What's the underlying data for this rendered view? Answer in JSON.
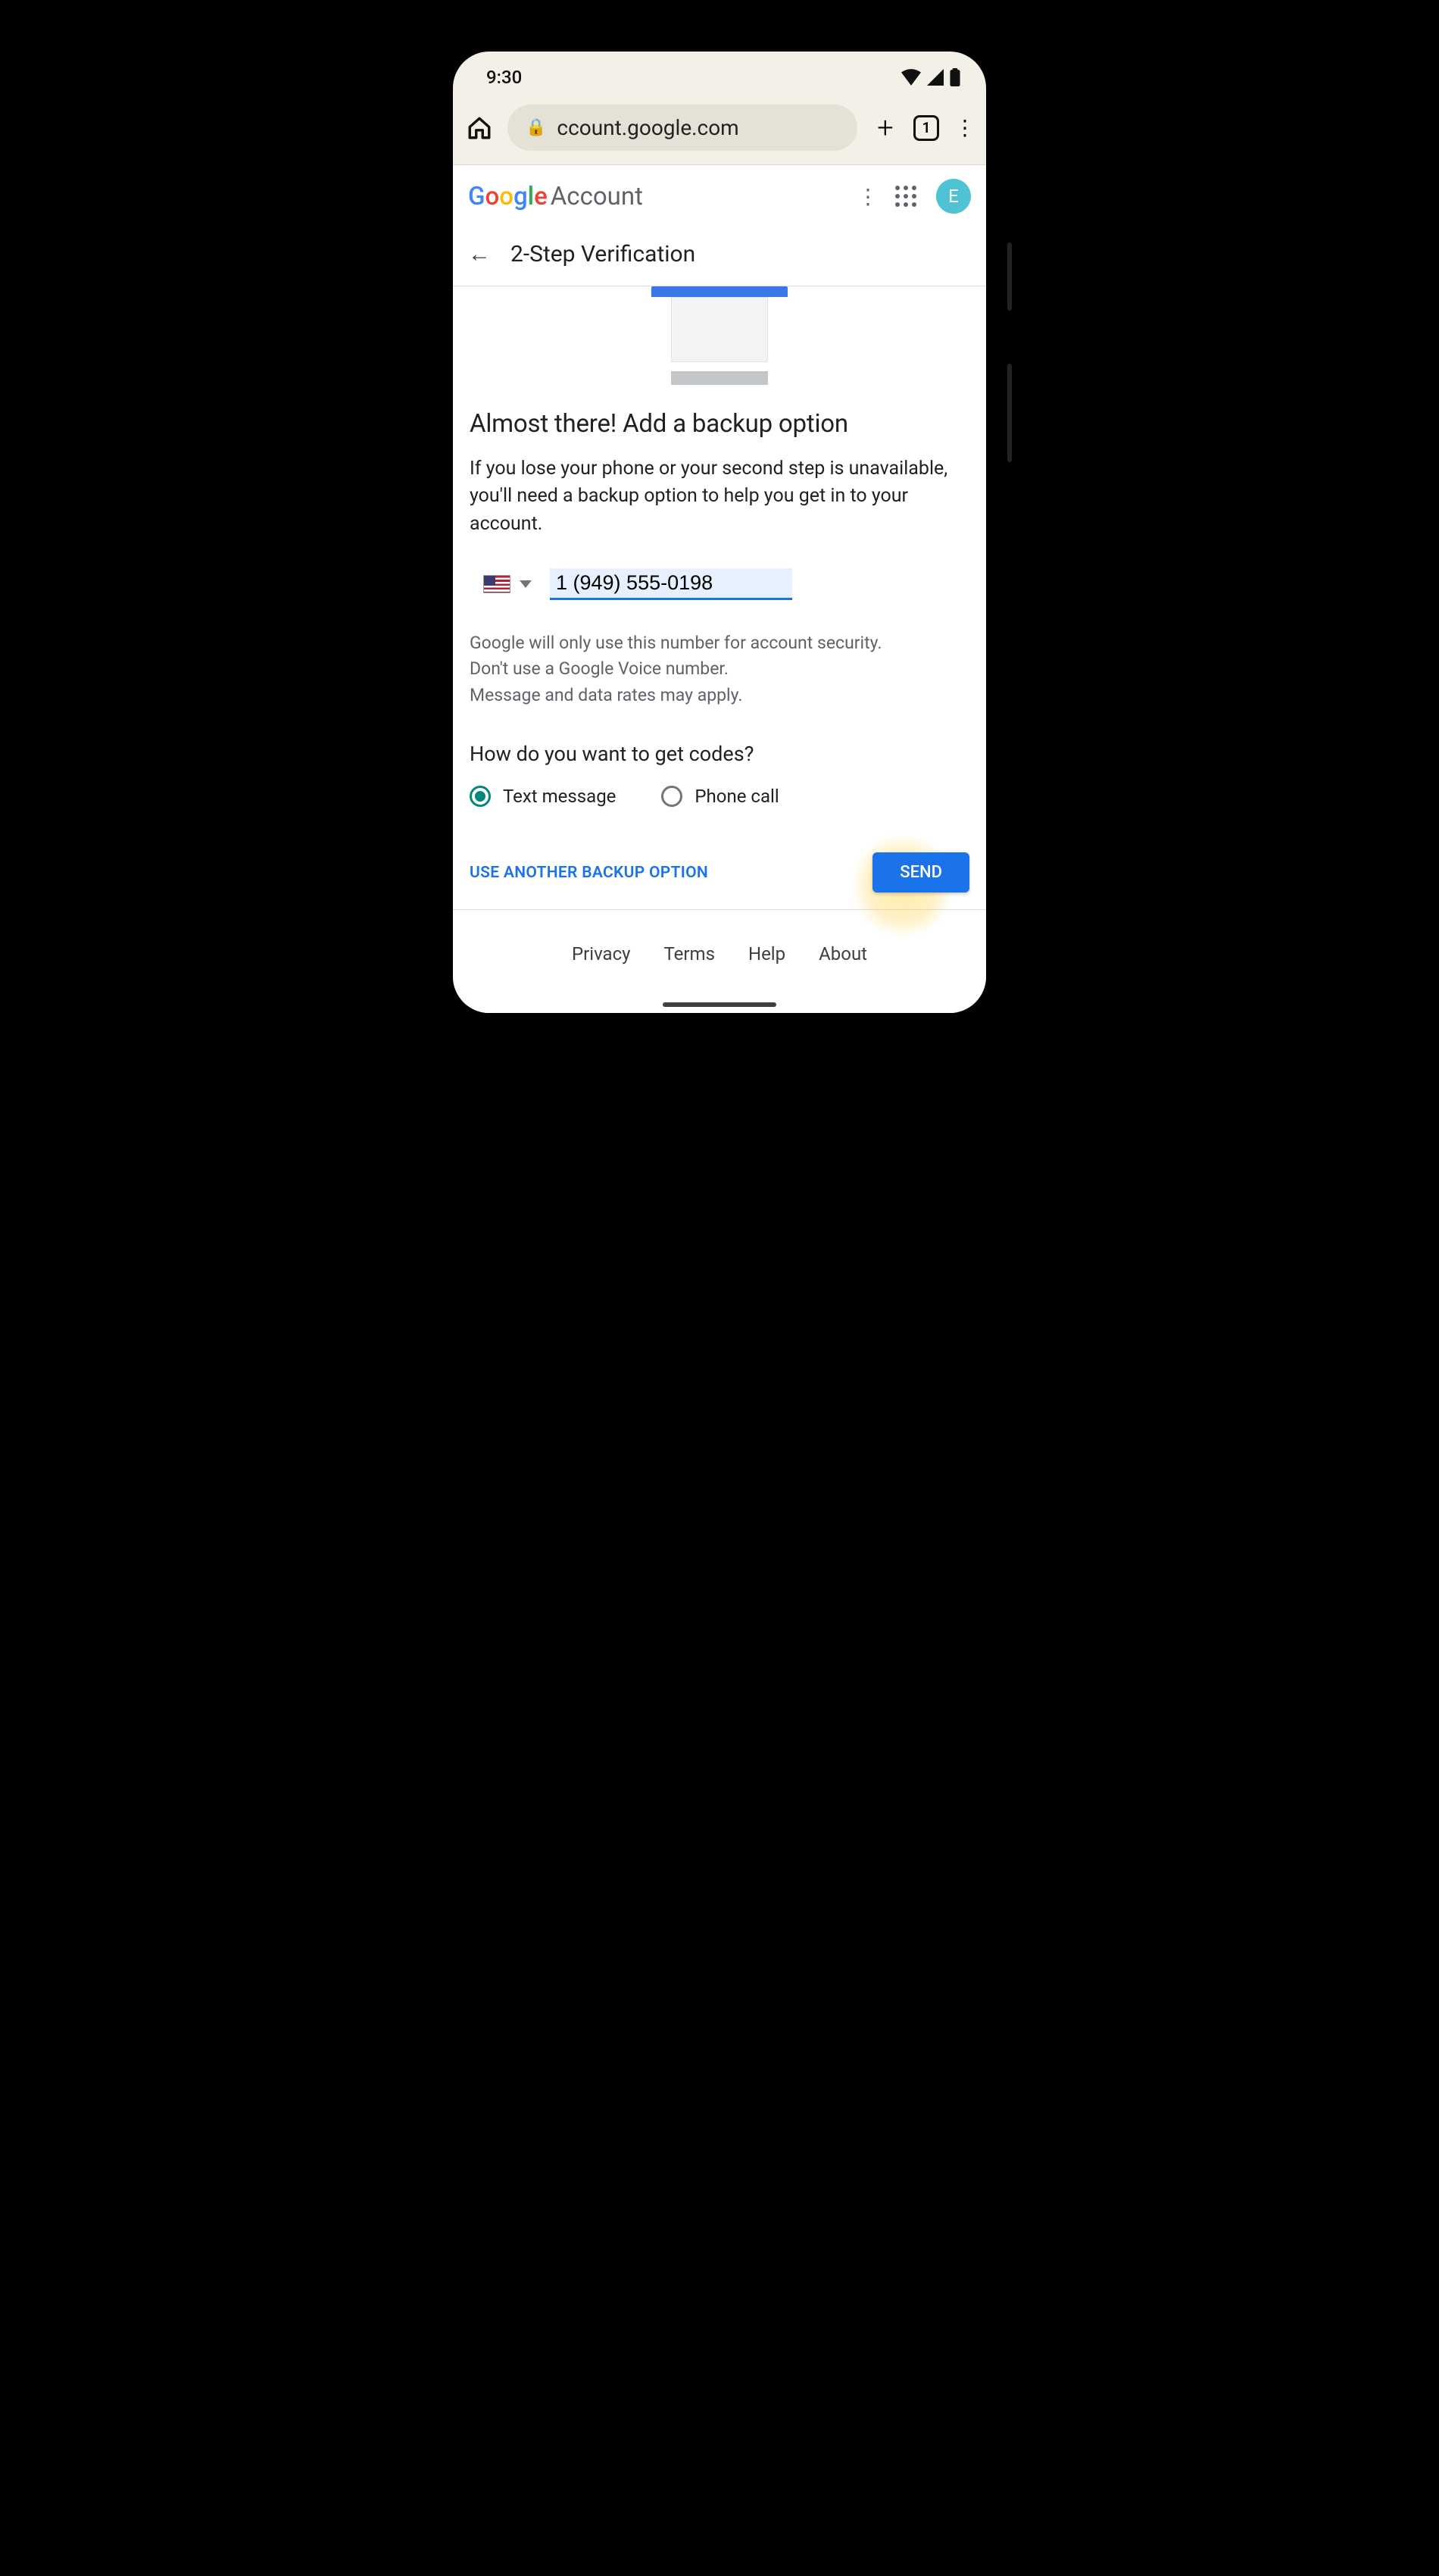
{
  "status": {
    "time": "9:30"
  },
  "browser": {
    "url": "ccount.google.com",
    "tab_count": "1"
  },
  "header": {
    "brand_g": "G",
    "brand_o1": "o",
    "brand_o2": "o",
    "brand_g2": "g",
    "brand_l": "l",
    "brand_e": "e",
    "account_label": "Account",
    "avatar_initial": "E"
  },
  "breadcrumb": {
    "title": "2-Step Verification"
  },
  "main": {
    "title": "Almost there! Add a backup option",
    "description": "If you lose your phone or your second step is unavailable, you'll need a backup option to help you get in to your account.",
    "phone_value": "1 (949) 555-0198",
    "help_line1": "Google will only use this number for account security.",
    "help_line2": "Don't use a Google Voice number.",
    "help_line3": "Message and data rates may apply.",
    "codes_heading": "How do you want to get codes?",
    "radio_text": "Text message",
    "radio_call": "Phone call",
    "alt_backup": "USE ANOTHER BACKUP OPTION",
    "send": "SEND"
  },
  "footer": {
    "privacy": "Privacy",
    "terms": "Terms",
    "help": "Help",
    "about": "About"
  }
}
